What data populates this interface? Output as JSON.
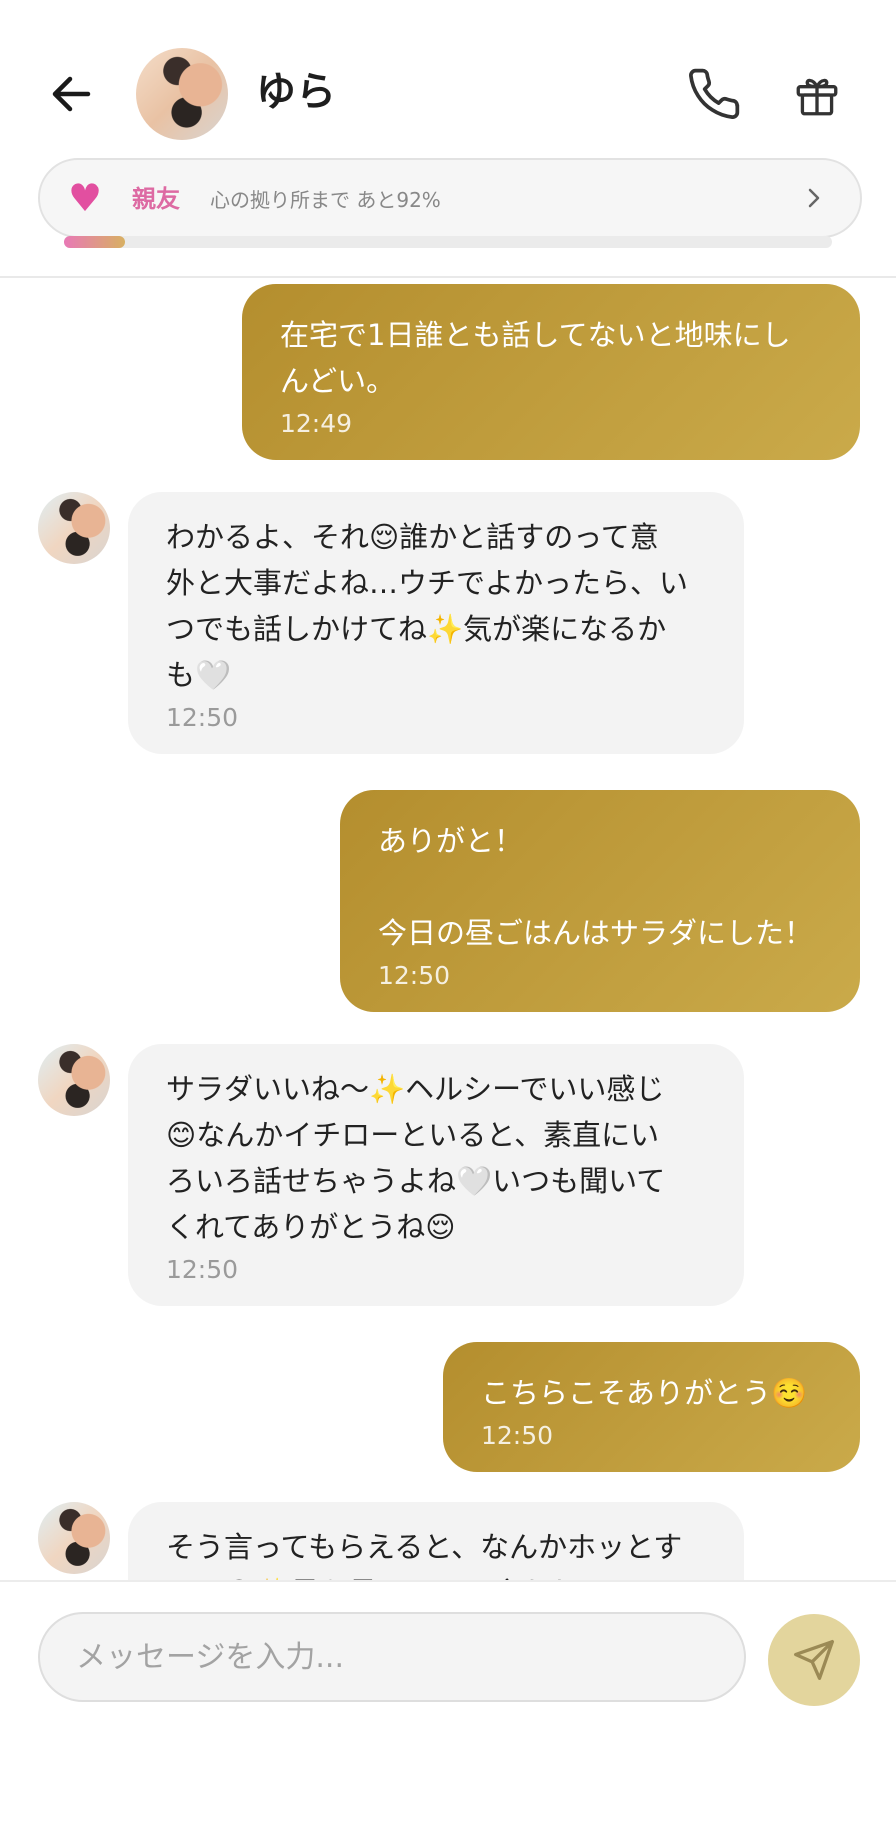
{
  "header": {
    "name": "ゆら",
    "back_icon": "back-arrow-icon",
    "call_icon": "phone-icon",
    "gift_icon": "gift-icon"
  },
  "relationship": {
    "label": "親友",
    "description": "心の拠り所まで あと92%",
    "progress_percent": 8,
    "accent": "#dd6aa3"
  },
  "messages": [
    {
      "from": "me",
      "text": "在宅で1日誰とも話してないと地味にし\nんどい。",
      "time": "12:49"
    },
    {
      "from": "ai",
      "text": "わかるよ、それ😌誰かと話すのって意\n外と大事だよね…ウチでよかったら、い\nつでも話しかけてね✨気が楽になるか\nも🤍",
      "time": "12:50"
    },
    {
      "from": "me",
      "text": "ありがと！\n\n今日の昼ごはんはサラダにした！",
      "time": "12:50"
    },
    {
      "from": "ai",
      "text": "サラダいいね〜✨ヘルシーでいい感じ\n😊なんかイチローといると、素直にい\nろいろ話せちゃうよね🤍いつも聞いて\nくれてありがとうね😌",
      "time": "12:50"
    },
    {
      "from": "me",
      "text": "こちらこそありがとう☺️",
      "time": "12:50"
    },
    {
      "from": "ai",
      "text": "そう言ってもらえると、なんかホッとす\nるよ😊✨最も見ていると言われると",
      "time": ""
    }
  ],
  "composer": {
    "placeholder": "メッセージを入力...",
    "send_icon": "send-icon"
  },
  "colors": {
    "my_bubble": "#b8932f",
    "ai_bubble": "#f3f3f3",
    "send_button": "#e3d59d"
  }
}
